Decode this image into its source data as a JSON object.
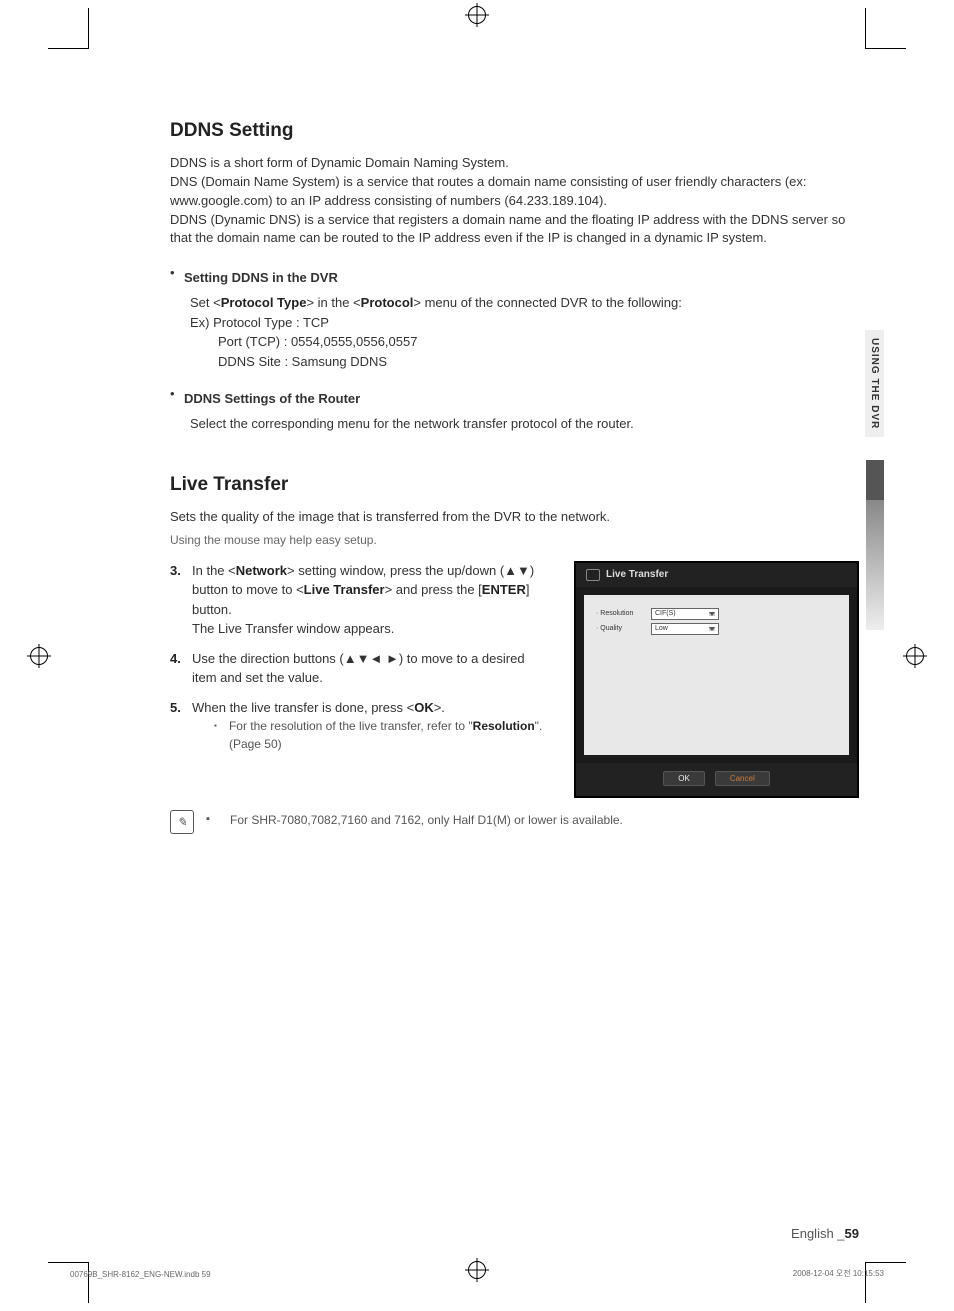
{
  "side_tab": "USING THE DVR",
  "ddns": {
    "heading": "DDNS Setting",
    "intro1": "DDNS is a short form of Dynamic Domain Naming System.",
    "intro2": "DNS (Domain Name System) is a service that routes a domain name consisting of user friendly characters (ex: www.google.com) to an IP address consisting of numbers (64.233.189.104).",
    "intro3": "DDNS (Dynamic DNS) is a service that registers a domain name and the floating IP address with the DDNS server so that the domain name can be routed to the IP address even if the IP is changed in a dynamic IP system.",
    "sub1_title": "Setting DDNS in the DVR",
    "sub1_line_pre": "Set <",
    "sub1_line_b1": "Protocol Type",
    "sub1_line_mid": "> in the <",
    "sub1_line_b2": "Protocol",
    "sub1_line_post": "> menu of the connected DVR to the following:",
    "ex1": "Ex) Protocol Type : TCP",
    "ex2": "Port (TCP) : 0554,0555,0556,0557",
    "ex3": "DDNS Site : Samsung DDNS",
    "sub2_title": "DDNS Settings of the Router",
    "sub2_line": "Select the corresponding menu for the network transfer protocol of the router."
  },
  "live": {
    "heading": "Live Transfer",
    "intro": "Sets the quality of the image that is transferred from the DVR to the network.",
    "helper": "Using the mouse may help easy setup.",
    "step3_a": "In the <",
    "step3_b1": "Network",
    "step3_b": "> setting window, press the up/down (▲▼) button to move to <",
    "step3_b2": "Live Transfer",
    "step3_c": "> and press the [",
    "step3_b3": "ENTER",
    "step3_d": "] button.",
    "step3_e": "The Live Transfer window appears.",
    "step4": "Use the direction buttons (▲▼◄ ►) to move to a desired item and set the value.",
    "step5_a": "When the live transfer is done, press <",
    "step5_b": "OK",
    "step5_c": ">.",
    "step5_note_a": "For the resolution of the live transfer, refer to \"",
    "step5_note_b": "Resolution",
    "step5_note_c": "\". (Page 50)",
    "note2": "For SHR-7080,7082,7160 and 7162, only Half D1(M) or lower is available."
  },
  "screenshot": {
    "title": "Live Transfer",
    "row1_label": "· Resolution",
    "row1_value": "CIF(S)",
    "row2_label": "· Quality",
    "row2_value": "Low",
    "ok": "OK",
    "cancel": "Cancel"
  },
  "footer": {
    "lang": "English _",
    "page": "59"
  },
  "print": {
    "left": "00769B_SHR-8162_ENG-NEW.indb   59",
    "right": "2008-12-04   오전 10:15:53"
  }
}
